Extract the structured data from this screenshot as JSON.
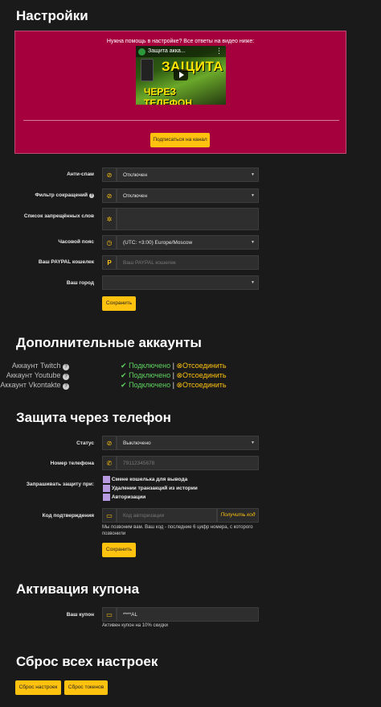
{
  "page_title": "Настройки",
  "promo": {
    "text": "Нужна помощь в настройке? Все ответы на видео ниже:",
    "video_title": "Защита акка...",
    "video_big_line1": "ЗАЩИТА",
    "video_big_line2": "ЧЕРЕЗ ТЕЛЕФОН",
    "subscribe_label": "Подписаться на канал"
  },
  "settings": {
    "antispam": {
      "label": "Анти-спам",
      "value": "Отключен"
    },
    "short_filter": {
      "label": "Фильтр сокращений",
      "value": "Отключен"
    },
    "banned_words": {
      "label": "Список запрещённых слов",
      "value": ""
    },
    "timezone": {
      "label": "Часовой пояс",
      "value": "(UTC: +3:00) Europe/Moscow"
    },
    "paypal": {
      "label": "Ваш PAYPAL кошелек",
      "placeholder": "Ваш PAYPAL кошелек"
    },
    "city": {
      "label": "Ваш город",
      "value": ""
    },
    "save_label": "Сохранить"
  },
  "accounts": {
    "title": "Дополнительные аккаунты",
    "items": [
      {
        "name": "Аккаунт Twitch",
        "status": "Подключено",
        "sep": "|",
        "action": "Отсоединить"
      },
      {
        "name": "Аккаунт Youtube",
        "status": "Подключено",
        "sep": "|",
        "action": "Отсоединить"
      },
      {
        "name": "Аккаунт Vkontakte",
        "status": "Подключено",
        "sep": "|",
        "action": "Отсоединить"
      }
    ]
  },
  "phone": {
    "title": "Защита через телефон",
    "status_label": "Статус",
    "status_value": "Выключено",
    "number_label": "Номер телефона",
    "number_placeholder": "79112345678",
    "ask_label": "Запрашивать защиту при:",
    "options": [
      "Смене кошелька для вывода",
      "Удалении транзакций из истории",
      "Авторизации"
    ],
    "code_label": "Код подтверждения",
    "code_placeholder": "Код авторизации",
    "get_code_label": "Получить код",
    "hint": "Мы позвоним вам. Ваш код - последние 6 цифр номера, с которого позвонили",
    "save_label": "Сохранить"
  },
  "coupon": {
    "title": "Активация купона",
    "label": "Ваш купон",
    "value": "****AL",
    "hint": "Активен купон на 10% скидки"
  },
  "reset": {
    "title": "Сброс всех настроек",
    "reset_settings_label": "Сброс настроек",
    "reset_tokens_label": "Сброс токенов"
  },
  "colors": {
    "accent": "#ffc20e",
    "promo_bg": "#a5003d",
    "ok": "#5fd35f",
    "checkbox": "#b79ae0"
  }
}
